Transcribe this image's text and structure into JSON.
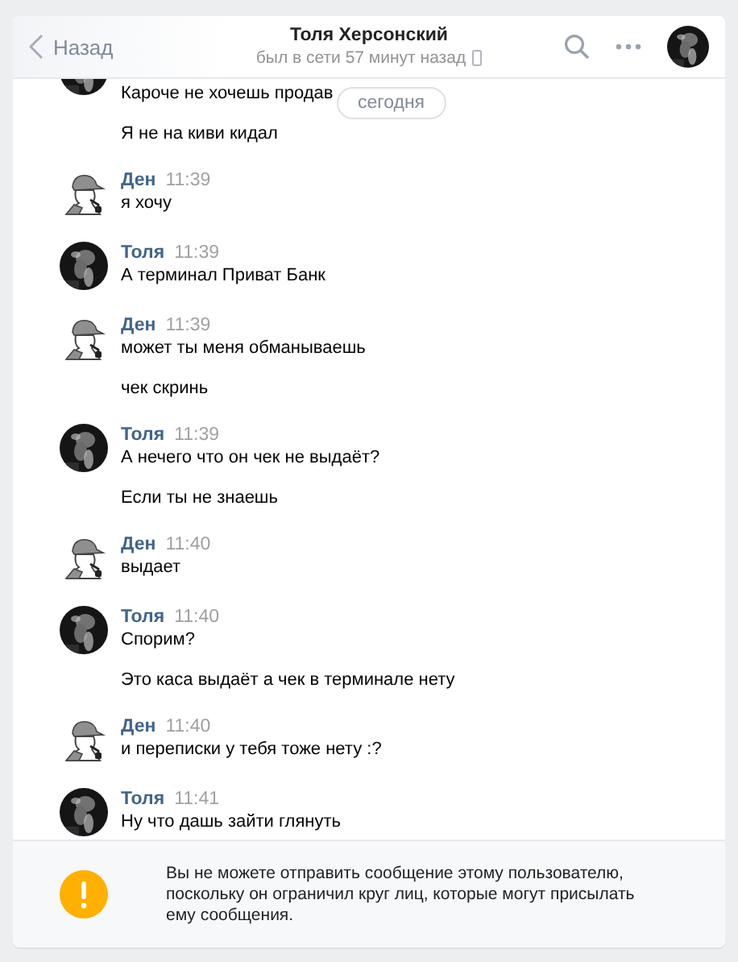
{
  "header": {
    "back": "Назад",
    "title": "Толя Херсонский",
    "status": "был в сети 57 минут назад"
  },
  "date_divider": "сегодня",
  "groups": [
    {
      "messages": [
        "Кароче не хочешь продав",
        "Я не на киви кидал"
      ]
    },
    {
      "kind": "silhouette",
      "name": "Ден",
      "time": "11:39",
      "messages": [
        "я хочу"
      ]
    },
    {
      "name": "Толя",
      "time": "11:39",
      "messages": [
        "А терминал Приват Банк"
      ]
    },
    {
      "kind": "silhouette",
      "name": "Ден",
      "time": "11:39",
      "messages": [
        "может ты меня обманываешь",
        "чек скринь"
      ]
    },
    {
      "name": "Толя",
      "time": "11:39",
      "messages": [
        "А нечего что он чек не выдаёт?",
        "Если ты не знаешь"
      ]
    },
    {
      "kind": "silhouette",
      "name": "Ден",
      "time": "11:40",
      "messages": [
        "выдает"
      ]
    },
    {
      "name": "Толя",
      "time": "11:40",
      "messages": [
        "Спорим?",
        "Это каса выдаёт а чек в терминале нету"
      ]
    },
    {
      "kind": "silhouette",
      "name": "Ден",
      "time": "11:40",
      "messages": [
        "и переписки у тебя тоже нету :?"
      ]
    },
    {
      "name": "Толя",
      "time": "11:41",
      "messages": [
        "Ну что дашь зайти глянуть"
      ]
    }
  ],
  "notice": "Вы не можете отправить сообщение этому пользователю, поскольку он ограничил круг лиц, которые могут присылать ему сообщения."
}
